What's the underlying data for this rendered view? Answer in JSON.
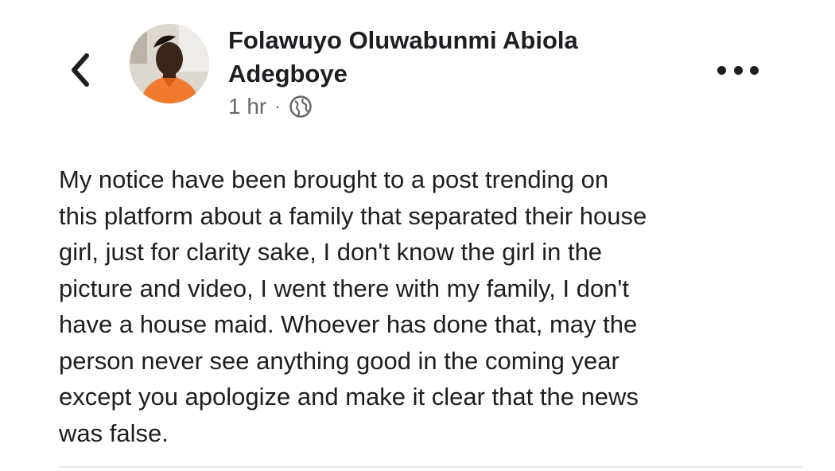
{
  "post": {
    "author_name": "Folawuyo Oluwabunmi Abiola Adegboye",
    "timestamp": "1 hr",
    "separator": "·",
    "privacy_icon": "globe-icon",
    "back_icon": "chevron-left-icon",
    "more_icon": "more-horizontal-icon",
    "text": "My notice have been brought to a post trending on\nthis platform about a family that separated their house\ngirl, just for clarity sake, I don't know the girl in the\npicture and video, I went there with my family,  I don't\nhave a house maid. Whoever has done that, may the\nperson never see anything good in the coming year\nexcept you apologize and make it clear that the news\nwas false."
  },
  "colors": {
    "text": "#1c1e21",
    "secondary": "#65676b",
    "avatar_shirt": "#f07a2e"
  }
}
